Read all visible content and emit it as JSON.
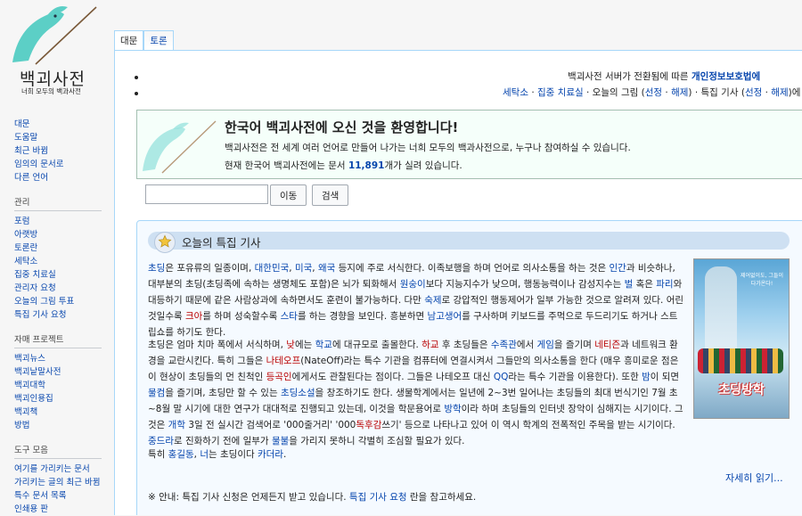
{
  "logo": {
    "title": "백괴사전",
    "subtitle": "너희 모두의 백과사전"
  },
  "sidebar": {
    "nav": [
      "대문",
      "도움말",
      "최근 바뀜",
      "임의의 문서로",
      "다른 언어"
    ],
    "sections": [
      {
        "heading": "관리",
        "items": [
          "포럼",
          "아랫방",
          "토론란",
          "세탁소",
          "집중 치료실",
          "관리자 요청",
          "오늘의 그림 투표",
          "특집 기사 요청"
        ]
      },
      {
        "heading": "자매 프로젝트",
        "items": [
          "백괴뉴스",
          "백괴낱말사전",
          "백괴대학",
          "백괴인용집",
          "백괴책",
          "방법"
        ]
      },
      {
        "heading": "도구 모음",
        "items": [
          "여기를 가리키는 문서",
          "가리키는 글의 최근 바뀜",
          "특수 문서 목록",
          "인쇄용 판"
        ]
      }
    ]
  },
  "tabs": [
    "대문",
    "토론"
  ],
  "notices": {
    "line1_text": "백괴사전 서버가 전환됨에 따른 ",
    "line1_link": "개인정보보호법에 ",
    "line2": [
      {
        "t": "세탁소",
        "link": true
      },
      {
        "t": " · ",
        "link": false
      },
      {
        "t": "집중 치료실",
        "link": true
      },
      {
        "t": " · 오늘의 그림 (",
        "link": false
      },
      {
        "t": "선정",
        "link": true
      },
      {
        "t": " · ",
        "link": false
      },
      {
        "t": "해제",
        "link": true
      },
      {
        "t": ") · 특집 기사 (",
        "link": false
      },
      {
        "t": "선정",
        "link": true
      },
      {
        "t": " · ",
        "link": false
      },
      {
        "t": "해제",
        "link": true
      },
      {
        "t": ")에 참",
        "link": false
      }
    ]
  },
  "welcome": {
    "title": "한국어 백괴사전에 오신 것을 환영합니다!",
    "line1": "백괴사전은 전 세계 여러 언어로 만들어 나가는 너희 모두의 백과사전으로, 누구나 참여하실 수 있습니다.",
    "line2_pre": "현재 한국어 백괴사전에는 문서 ",
    "article_count": "11,891",
    "line2_post": "개가 실려 있습니다."
  },
  "search": {
    "placeholder": "",
    "go_button": "이동",
    "search_button": "검색"
  },
  "featured": {
    "title": "오늘의 특집 기사",
    "para1": [
      {
        "t": "초딩",
        "c": "l"
      },
      {
        "t": "은 포유류의 일종이며, "
      },
      {
        "t": "대한민국",
        "c": "l"
      },
      {
        "t": ", "
      },
      {
        "t": "미국",
        "c": "l"
      },
      {
        "t": ", "
      },
      {
        "t": "왜국",
        "c": "l"
      },
      {
        "t": " 등지에 주로 서식한다. 이족보행을 하며 언어로 의사소통을 하는 것은 "
      },
      {
        "t": "인간",
        "c": "l"
      },
      {
        "t": "과 비슷하나, 대부분의 초딩(초딩족에 속하는 생명체도 포함)은 뇌가 퇴화해서 "
      },
      {
        "t": "원숭이",
        "c": "l"
      },
      {
        "t": "보다 지능지수가 낮으며, 행동능력이나 감성지수는 "
      },
      {
        "t": "벌",
        "c": "l"
      },
      {
        "t": " 혹은 "
      },
      {
        "t": "파리",
        "c": "l"
      },
      {
        "t": "와 대등하기 때문에 같은 사람상과에 속하면서도 훈련이 불가능하다. 다만 "
      },
      {
        "t": "숙제",
        "c": "l"
      },
      {
        "t": "로 강압적인 행동제어가 일부 가능한 것으로 알려져 있다. 어린 것일수록 "
      },
      {
        "t": "크아",
        "c": "r"
      },
      {
        "t": "를 하며 성숙할수록 "
      },
      {
        "t": "스타",
        "c": "l"
      },
      {
        "t": "를 하는 경향을 보인다. 흥분하면 "
      },
      {
        "t": "남고생어",
        "c": "l"
      },
      {
        "t": "를 구사하며 키보드를 주먹으로 두드리기도 하거나 스트립쇼를 하기도 한다."
      }
    ],
    "para2": [
      {
        "t": "초딩은 엄마 치마 폭에서 서식하며, "
      },
      {
        "t": "낮",
        "c": "r"
      },
      {
        "t": "에는 "
      },
      {
        "t": "학교",
        "c": "l"
      },
      {
        "t": "에 대규모로 출몰한다. "
      },
      {
        "t": "하교",
        "c": "r"
      },
      {
        "t": " 후 초딩들은 "
      },
      {
        "t": "수족관",
        "c": "l"
      },
      {
        "t": "에서 "
      },
      {
        "t": "게임",
        "c": "l"
      },
      {
        "t": "을 즐기며 "
      },
      {
        "t": "네티즌",
        "c": "r"
      },
      {
        "t": "과 네트워크 환경을 교란시킨다. 특히 그들은 "
      },
      {
        "t": "나테오프",
        "c": "r"
      },
      {
        "t": "(NateOff)라는 특수 기관을 컴퓨터에 연결시켜서 그들만의 의사소통을 한다 (매우 흥미로운 점은 이 현상이 초딩들의 먼 친척인 "
      },
      {
        "t": "등곡인",
        "c": "r"
      },
      {
        "t": "에게서도 관찰된다는 점이다. 그들은 나테오프 대신 "
      },
      {
        "t": "QQ",
        "c": "l"
      },
      {
        "t": "라는 특수 기관을 이용한다). 또한 "
      },
      {
        "t": "밤",
        "c": "l"
      },
      {
        "t": "이 되면 "
      },
      {
        "t": "물컴",
        "c": "l"
      },
      {
        "t": "을 즐기며, 초딩만 할 수 있는 "
      },
      {
        "t": "초딩소설",
        "c": "l"
      },
      {
        "t": "을 창조하기도 한다. 생물학계에서는 일년에 2~3번 일어나는 초딩들의 최대 번식기인 7월 초~8월 말 시기에 대한 연구가 대대적로 진행되고 있는데, 이것을 학문용어로 "
      },
      {
        "t": "방학",
        "c": "l"
      },
      {
        "t": "이라 하며 초딩들의 인터넷 장악이 심해지는 시기이다. 그것은 "
      },
      {
        "t": "개학",
        "c": "l"
      },
      {
        "t": " 3일 전 실시간 검색어로 '000줄거리' '000"
      },
      {
        "t": "독후감",
        "c": "r"
      },
      {
        "t": "쓰기' 등으로 나타나고 있어 이 역시 학계의 전폭적인 주목을 받는 시기이다. "
      },
      {
        "t": "중드라",
        "c": "l"
      },
      {
        "t": "로 진화하기 전에 일부가 "
      },
      {
        "t": "물불",
        "c": "l"
      },
      {
        "t": "을 가리지 못하니 각별히 조심할 필요가 있다."
      }
    ],
    "para3": [
      {
        "t": "특히 "
      },
      {
        "t": "홍길동",
        "c": "l"
      },
      {
        "t": ", "
      },
      {
        "t": "너",
        "c": "l"
      },
      {
        "t": "는 초딩이다 "
      },
      {
        "t": "카더라",
        "c": "l"
      },
      {
        "t": "."
      }
    ],
    "poster": {
      "tagline": "제어없이도, 그들이 다가온다!",
      "title": "초딩방학"
    },
    "read_more": "자세히 읽기...",
    "notice_pre": "※ 안내: 특집 기사 신청은 언제든지 받고 있습니다. ",
    "notice_link": "특집 기사 요청",
    "notice_post": " 란을 참고하세요."
  },
  "colors": {
    "link": "#0645ad",
    "redlink": "#ba0000",
    "welcome_bg": "#f5fffa",
    "featured_bg": "#f5faff",
    "featured_head": "#cee0f2"
  }
}
